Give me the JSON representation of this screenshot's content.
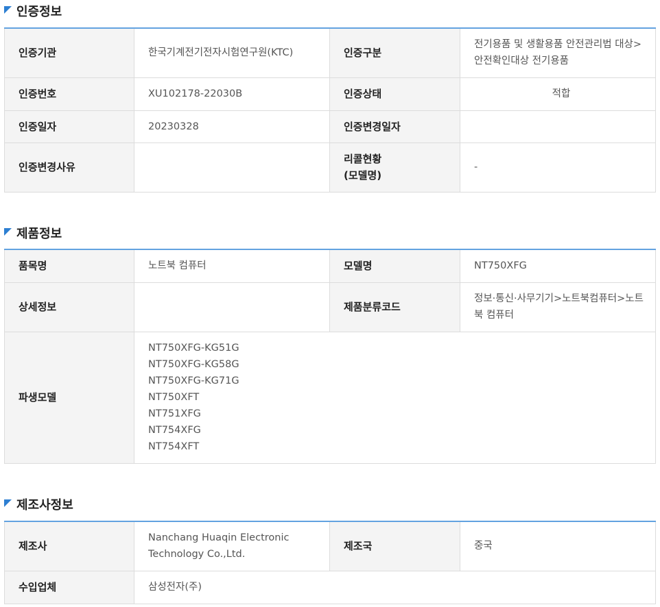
{
  "cert": {
    "title": "인증정보",
    "agency_label": "인증기관",
    "agency_value": "한국기계전기전자시험연구원(KTC)",
    "type_label": "인증구분",
    "type_value": "전기용품 및 생활용품 안전관리법 대상>안전확인대상 전기용품",
    "number_label": "인증번호",
    "number_value": "XU102178-22030B",
    "status_label": "인증상태",
    "status_value": "적합",
    "date_label": "인증일자",
    "date_value": "20230328",
    "change_date_label": "인증변경일자",
    "change_date_value": "",
    "change_reason_label": "인증변경사유",
    "change_reason_value": "",
    "recall_label_line1": "리콜현황",
    "recall_label_line2": "(모델명)",
    "recall_value": "-"
  },
  "product": {
    "title": "제품정보",
    "item_label": "품목명",
    "item_value": "노트북 컴퓨터",
    "model_label": "모델명",
    "model_value": "NT750XFG",
    "detail_label": "상세정보",
    "detail_value": "",
    "code_label": "제품분류코드",
    "code_value": "정보·통신·사무기기>노트북컴퓨터>노트북 컴퓨터",
    "derived_label": "파생모델",
    "derived_models": [
      "NT750XFG-KG51G",
      "NT750XFG-KG58G",
      "NT750XFG-KG71G",
      "NT750XFT",
      "NT751XFG",
      "NT754XFG",
      "NT754XFT"
    ]
  },
  "maker": {
    "title": "제조사정보",
    "maker_label": "제조사",
    "maker_value": "Nanchang Huaqin Electronic Technology Co.,Ltd.",
    "country_label": "제조국",
    "country_value": "중국",
    "importer_label": "수입업체",
    "importer_value": "삼성전자(주)"
  }
}
